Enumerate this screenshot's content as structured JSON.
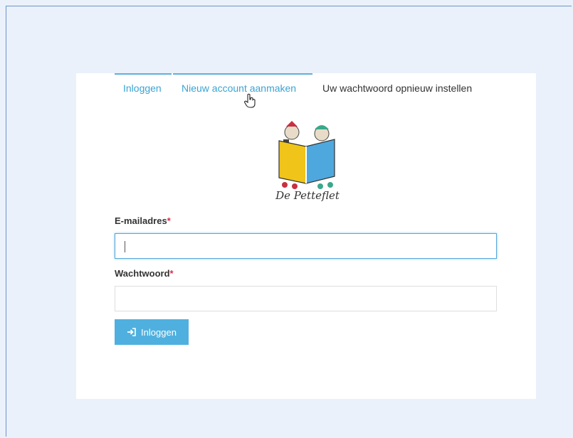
{
  "tabs": [
    {
      "label": "Inloggen"
    },
    {
      "label": "Nieuw account aanmaken"
    },
    {
      "label": "Uw wachtwoord opnieuw instellen"
    }
  ],
  "logo": {
    "text": "De Petteflet"
  },
  "form": {
    "email_label": "E-mailadres",
    "password_label": "Wachtwoord",
    "required_mark": "*",
    "email_value": "",
    "password_value": "",
    "submit_label": "Inloggen"
  },
  "colors": {
    "accent": "#4fb0df",
    "required": "#e0294a",
    "page_bg": "#eaf1fa"
  },
  "icons": {
    "submit": "sign-in-icon",
    "cursor": "hand-pointer-icon"
  }
}
